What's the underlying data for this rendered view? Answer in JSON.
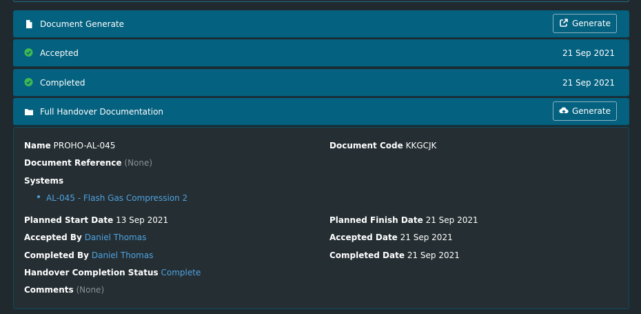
{
  "bars": {
    "document_generate": {
      "label": "Document Generate",
      "button": "Generate"
    },
    "accepted": {
      "label": "Accepted",
      "date": "21 Sep 2021"
    },
    "completed": {
      "label": "Completed",
      "date": "21 Sep 2021"
    },
    "full_handover": {
      "label": "Full Handover Documentation",
      "button": "Generate"
    }
  },
  "details": {
    "name": {
      "label": "Name",
      "value": "PROHO-AL-045"
    },
    "document_code": {
      "label": "Document Code",
      "value": "KKGCJK"
    },
    "document_reference": {
      "label": "Document Reference",
      "value": "(None)"
    },
    "systems": {
      "label": "Systems",
      "items": [
        "AL-045 - Flash Gas Compression 2"
      ]
    },
    "planned_start_date": {
      "label": "Planned Start Date",
      "value": "13 Sep 2021"
    },
    "planned_finish_date": {
      "label": "Planned Finish Date",
      "value": "21 Sep 2021"
    },
    "accepted_by": {
      "label": "Accepted By",
      "value": "Daniel Thomas"
    },
    "accepted_date": {
      "label": "Accepted Date",
      "value": "21 Sep 2021"
    },
    "completed_by": {
      "label": "Completed By",
      "value": "Daniel Thomas"
    },
    "completed_date": {
      "label": "Completed Date",
      "value": "21 Sep 2021"
    },
    "handover_completion_status": {
      "label": "Handover Completion Status",
      "value": "Complete"
    },
    "comments": {
      "label": "Comments",
      "value": "(None)"
    }
  },
  "colors": {
    "bar_background": "#04617f",
    "page_background": "#20292e",
    "panel_background": "#252e33",
    "link": "#4fa3e0",
    "success": "#3fb950",
    "muted": "#8a9296"
  },
  "icons": {
    "document_generate": "file-icon",
    "accepted": "check-circle-icon",
    "completed": "check-circle-icon",
    "full_handover": "folder-icon",
    "generate_button": "external-link-icon",
    "handover_generate_button": "cloud-upload-icon"
  }
}
